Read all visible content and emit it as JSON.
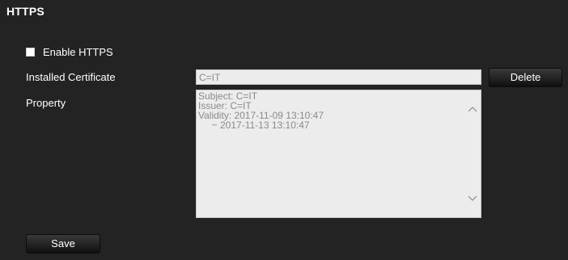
{
  "page": {
    "title": "HTTPS"
  },
  "enable_https": {
    "label": "Enable HTTPS",
    "checked": false
  },
  "certificate": {
    "label": "Installed Certificate",
    "value": "C=IT",
    "delete_label": "Delete"
  },
  "property": {
    "label": "Property",
    "lines": [
      "Subject: C=IT",
      "Issuer: C=IT",
      "Validity: 2017-11-09 13:10:47",
      "     ~ 2017-11-13 13:10:47"
    ]
  },
  "save_label": "Save",
  "icons": {
    "scroll_up": "chevron-up-icon",
    "scroll_down": "chevron-down-icon"
  },
  "colors": {
    "panel_background": "#232323",
    "field_background": "#ececec",
    "field_text": "#8a8a8a"
  }
}
